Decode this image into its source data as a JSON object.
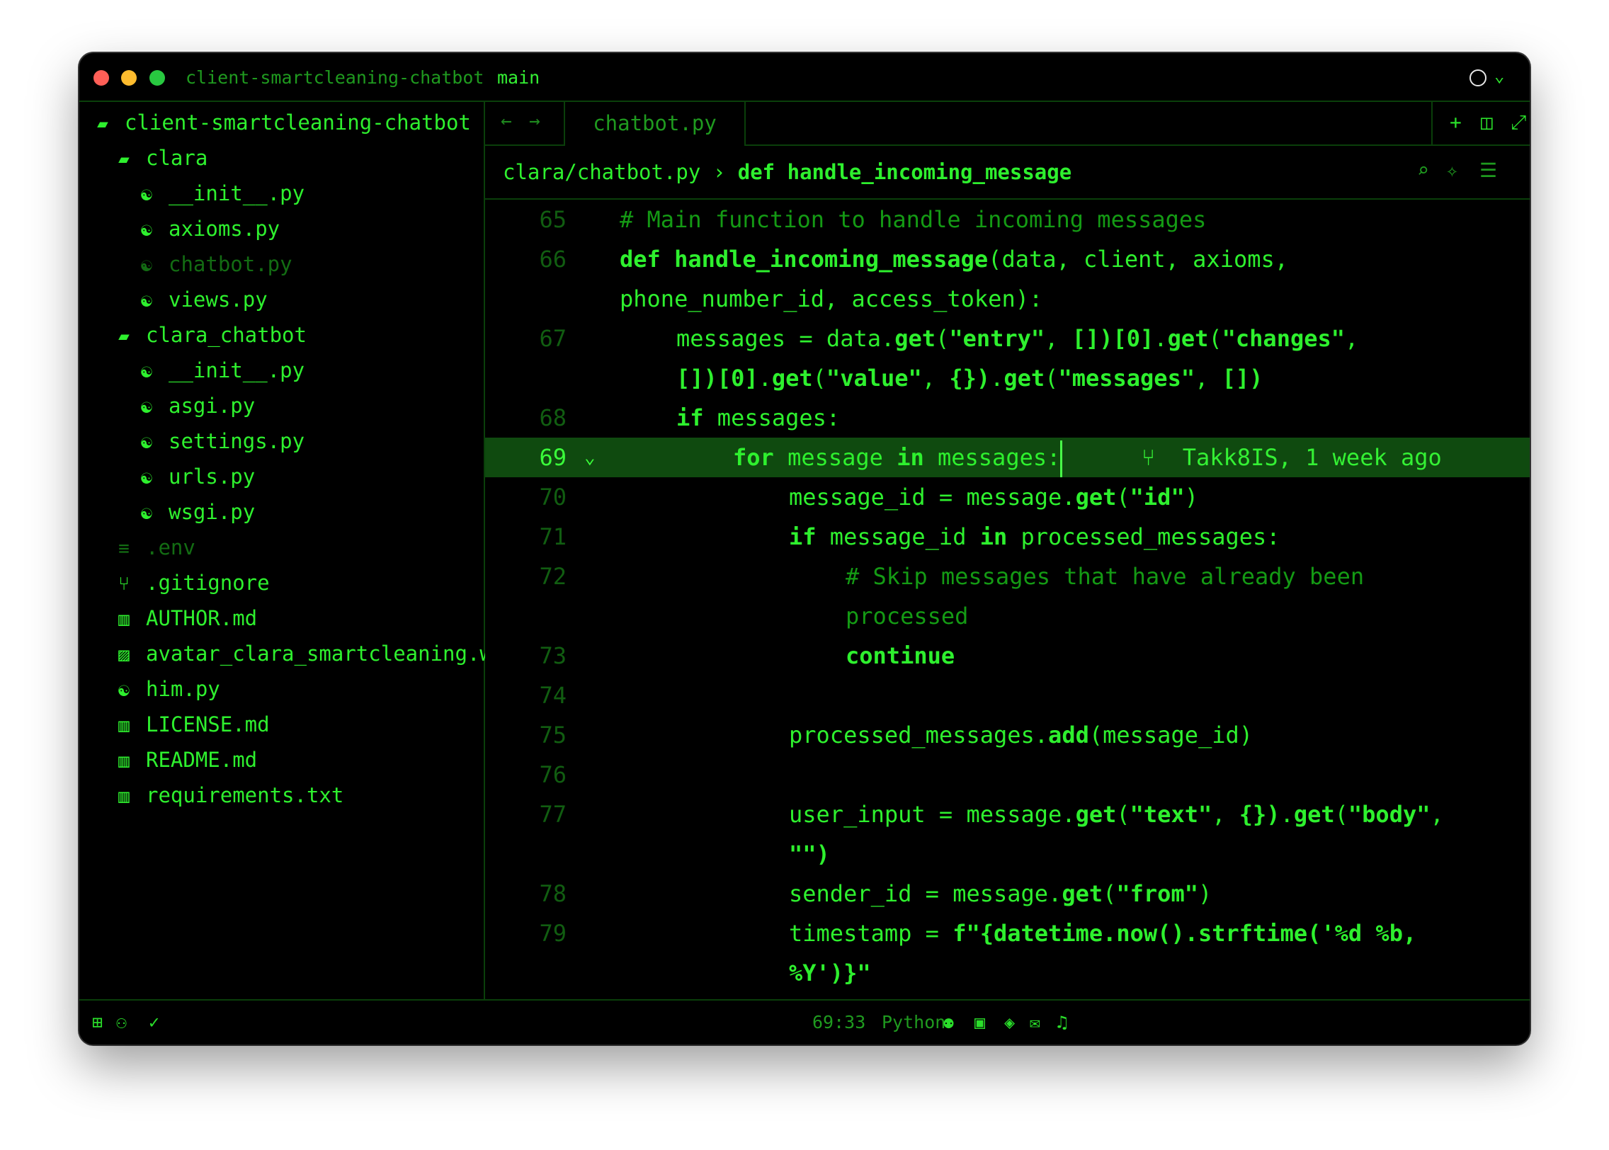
{
  "titlebar": {
    "project": "client-smartcleaning-chatbot",
    "branch": "main"
  },
  "sidebar": {
    "items": [
      {
        "label": "client-smartcleaning-chatbot",
        "icon": "folder-open-icon",
        "glyph": "▰",
        "dim": false
      },
      {
        "label": "clara",
        "icon": "folder-open-icon",
        "glyph": "▰",
        "dim": false
      },
      {
        "label": "__init__.py",
        "icon": "python-icon",
        "glyph": "☯",
        "dim": false
      },
      {
        "label": "axioms.py",
        "icon": "python-icon",
        "glyph": "☯",
        "dim": false
      },
      {
        "label": "chatbot.py",
        "icon": "python-icon",
        "glyph": "☯",
        "dim": true
      },
      {
        "label": "views.py",
        "icon": "python-icon",
        "glyph": "☯",
        "dim": false
      },
      {
        "label": "clara_chatbot",
        "icon": "folder-open-icon",
        "glyph": "▰",
        "dim": false
      },
      {
        "label": "__init__.py",
        "icon": "python-icon",
        "glyph": "☯",
        "dim": false
      },
      {
        "label": "asgi.py",
        "icon": "python-icon",
        "glyph": "☯",
        "dim": false
      },
      {
        "label": "settings.py",
        "icon": "python-icon",
        "glyph": "☯",
        "dim": false
      },
      {
        "label": "urls.py",
        "icon": "python-icon",
        "glyph": "☯",
        "dim": false
      },
      {
        "label": "wsgi.py",
        "icon": "python-icon",
        "glyph": "☯",
        "dim": false
      },
      {
        "label": ".env",
        "icon": "lines-icon",
        "glyph": "≡",
        "dim": true
      },
      {
        "label": ".gitignore",
        "icon": "git-branch-icon",
        "glyph": "⑂",
        "dim": false
      },
      {
        "label": "AUTHOR.md",
        "icon": "book-icon",
        "glyph": "▥",
        "dim": false
      },
      {
        "label": "avatar_clara_smartcleaning.webp",
        "icon": "image-icon",
        "glyph": "▨",
        "dim": false
      },
      {
        "label": "him.py",
        "icon": "python-icon",
        "glyph": "☯",
        "dim": false
      },
      {
        "label": "LICENSE.md",
        "icon": "book-icon",
        "glyph": "▥",
        "dim": false
      },
      {
        "label": "README.md",
        "icon": "book-icon",
        "glyph": "▥",
        "dim": false
      },
      {
        "label": "requirements.txt",
        "icon": "book-icon",
        "glyph": "▥",
        "dim": false
      }
    ]
  },
  "tabs": {
    "active": "chatbot.py"
  },
  "breadcrumb": {
    "path": "clara/chatbot.py",
    "separator": "›",
    "symbol": "def handle_incoming_message"
  },
  "editor": {
    "lines": [
      {
        "n": "65",
        "indent": 0,
        "html": "<span class=\"cmt\"># Main function to handle incoming messages</span>"
      },
      {
        "n": "66",
        "indent": 0,
        "html": "<span class=\"kw\">def</span> <span class=\"fn\">handle_incoming_message</span>(data, client, axioms,"
      },
      {
        "n": "",
        "indent": 0,
        "html": "phone_number_id, access_token):"
      },
      {
        "n": "67",
        "indent": 1,
        "html": "messages = data.<span class=\"fn\">get</span>(<span class=\"str\">\"entry\"</span>, <span class=\"str\">[])[0]</span>.<span class=\"fn\">get</span>(<span class=\"str\">\"changes\"</span>,"
      },
      {
        "n": "",
        "indent": 1,
        "html": "<span class=\"str\">[])[0]</span>.<span class=\"fn\">get</span>(<span class=\"str\">\"value\"</span>, <span class=\"str\">{})</span>.<span class=\"fn\">get</span>(<span class=\"str\">\"messages\"</span>, <span class=\"str\">[])</span>"
      },
      {
        "n": "68",
        "indent": 1,
        "html": "<span class=\"kw\">if</span> messages:"
      },
      {
        "n": "69",
        "indent": 2,
        "active": true,
        "html": "<span class=\"kw\">for</span> message <span class=\"kw\">in</span> messages:"
      },
      {
        "n": "70",
        "indent": 3,
        "html": "message_id = message.<span class=\"fn\">get</span>(<span class=\"str\">\"id\"</span>)"
      },
      {
        "n": "71",
        "indent": 3,
        "html": "<span class=\"kw\">if</span> message_id <span class=\"kw\">in</span> processed_messages:"
      },
      {
        "n": "72",
        "indent": 4,
        "html": "<span class=\"cmt\"># Skip messages that have already been</span>"
      },
      {
        "n": "",
        "indent": 4,
        "html": "<span class=\"cmt\">processed</span>"
      },
      {
        "n": "73",
        "indent": 4,
        "html": "<span class=\"kw\">continue</span>"
      },
      {
        "n": "74",
        "indent": 0,
        "html": ""
      },
      {
        "n": "75",
        "indent": 3,
        "html": "processed_messages.<span class=\"fn\">add</span>(message_id)"
      },
      {
        "n": "76",
        "indent": 0,
        "html": ""
      },
      {
        "n": "77",
        "indent": 3,
        "html": "user_input = message.<span class=\"fn\">get</span>(<span class=\"str\">\"text\"</span>, <span class=\"str\">{})</span>.<span class=\"fn\">get</span>(<span class=\"str\">\"body\"</span>,"
      },
      {
        "n": "",
        "indent": 3,
        "html": "<span class=\"str\">\"\")</span>"
      },
      {
        "n": "78",
        "indent": 3,
        "html": "sender_id = message.<span class=\"fn\">get</span>(<span class=\"str\">\"from\"</span>)"
      },
      {
        "n": "79",
        "indent": 3,
        "html": "timestamp = <span class=\"str\">f\"{datetime.now().strftime('%d %b,</span>"
      },
      {
        "n": "",
        "indent": 3,
        "html": "<span class=\"str\">%Y')}\"</span>"
      }
    ],
    "blame": "Takk8IS, 1 week ago"
  },
  "statusbar": {
    "cursor_position": "69:33",
    "language": "Python"
  },
  "colors": {
    "accent": "#2ef02e",
    "dim": "#136c13",
    "active_line": "#0f4a0f",
    "background": "#000000"
  }
}
